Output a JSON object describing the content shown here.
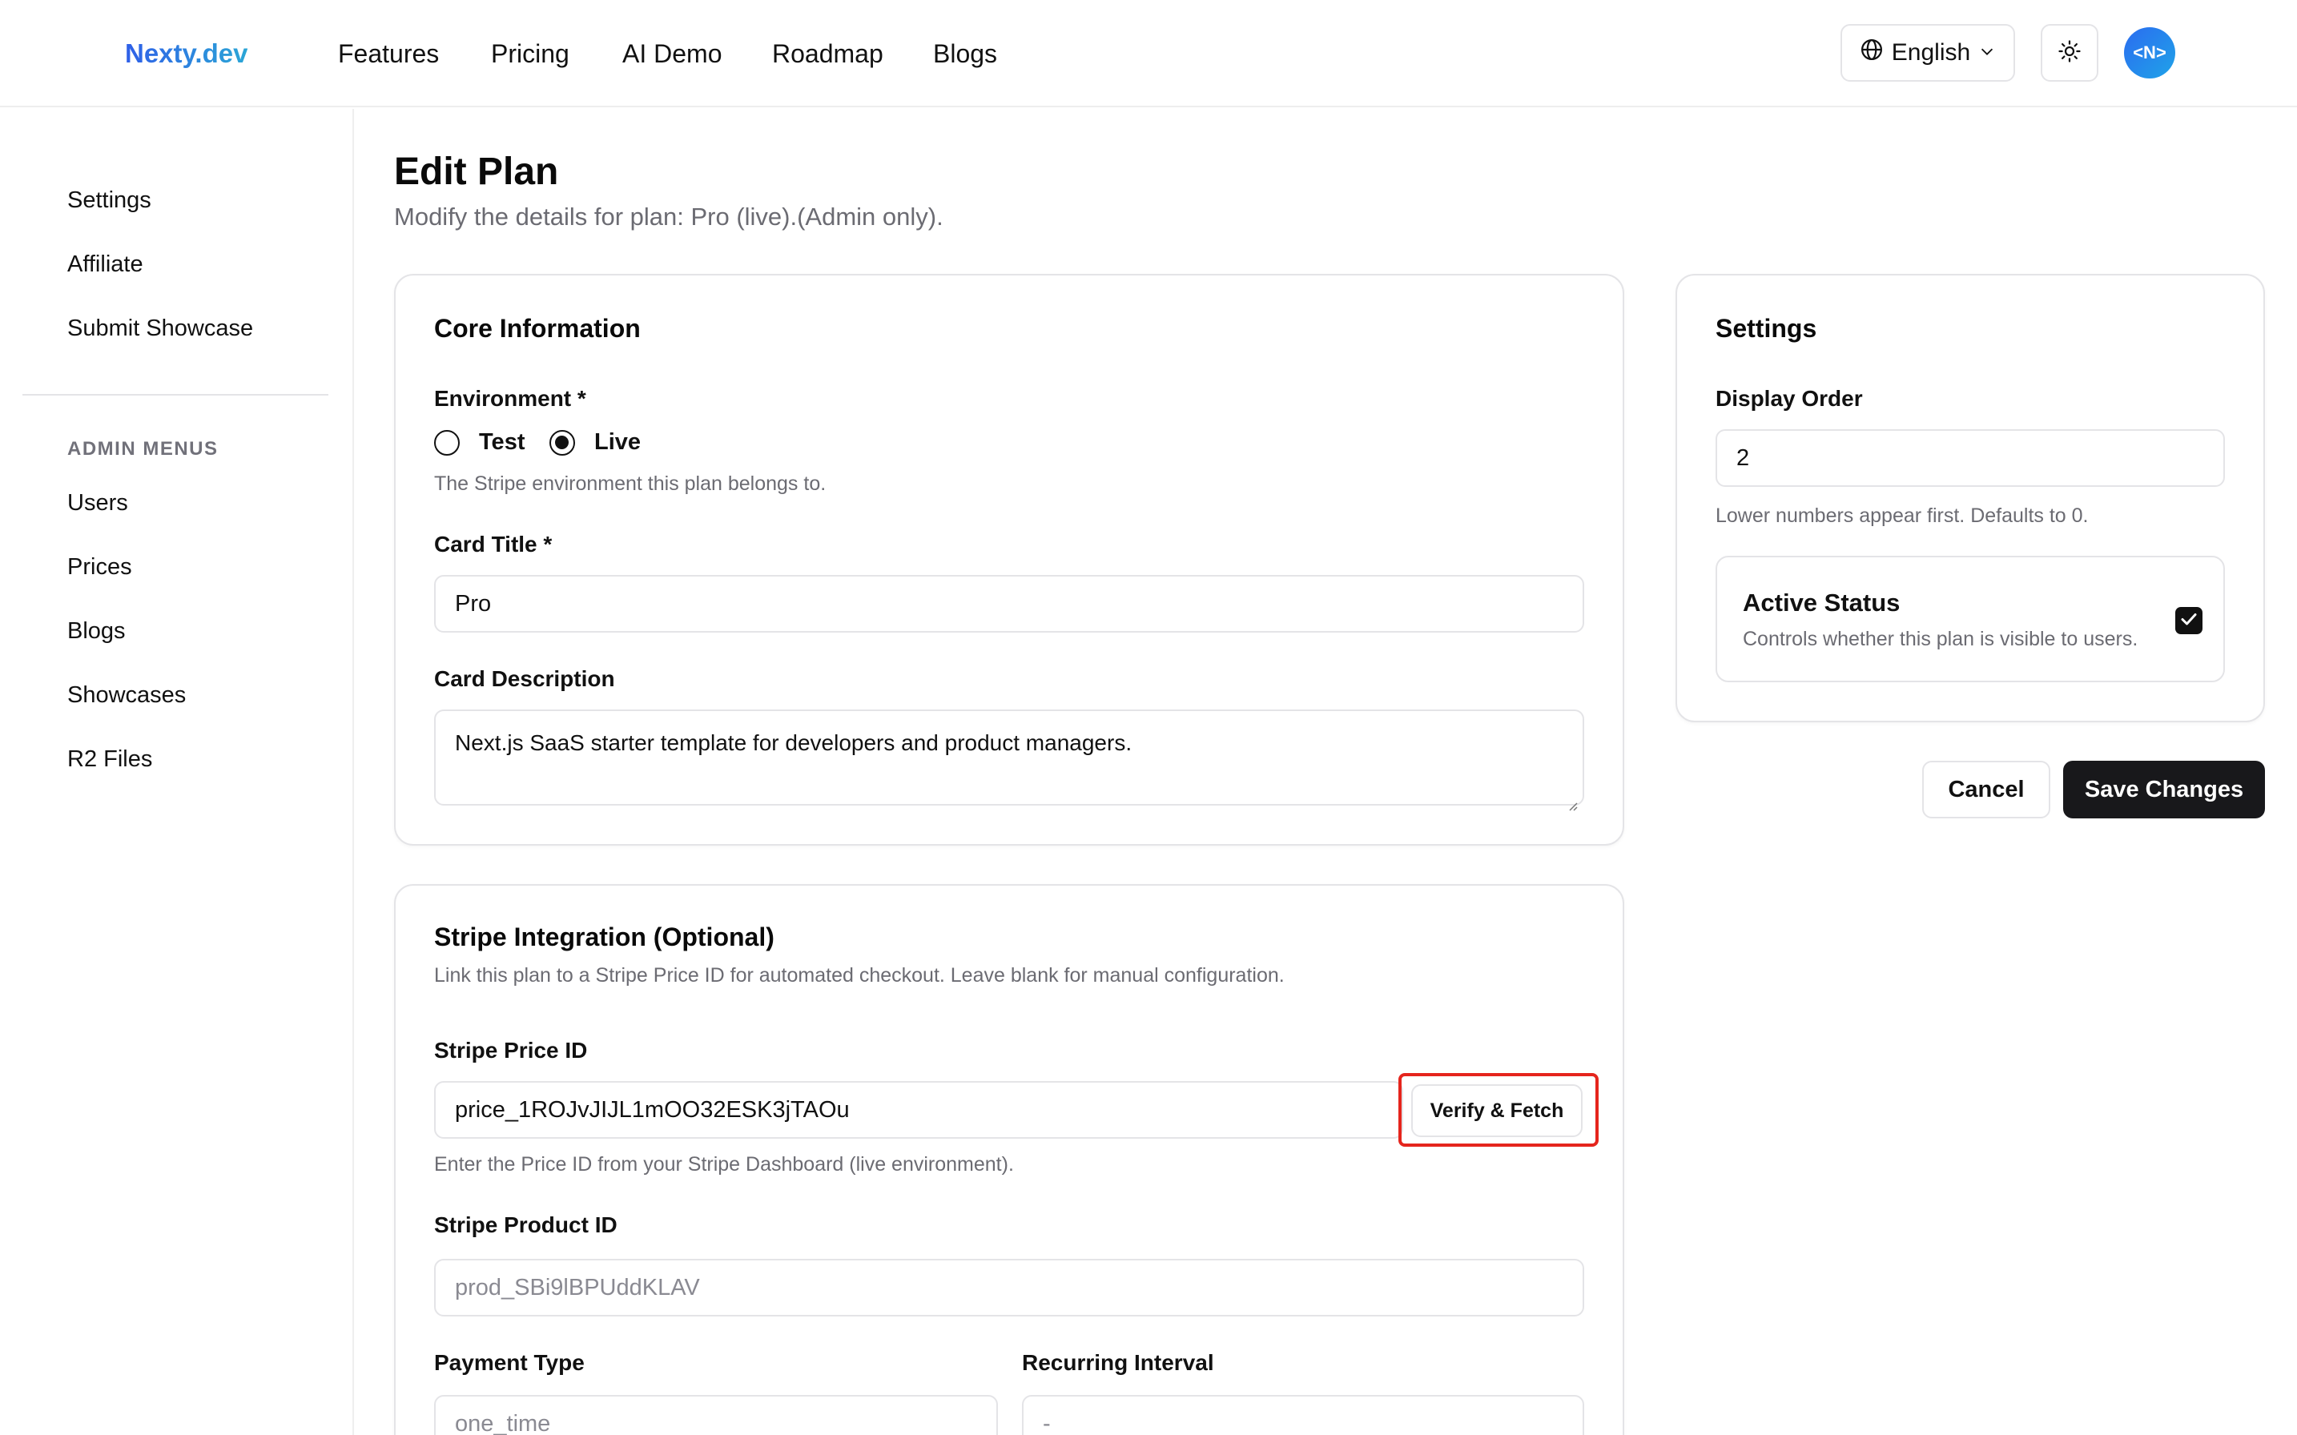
{
  "header": {
    "logo": "Nexty.dev",
    "nav": [
      "Features",
      "Pricing",
      "AI Demo",
      "Roadmap",
      "Blogs"
    ],
    "language": "English",
    "avatar_text": "<N>"
  },
  "sidebar": {
    "items": [
      "Settings",
      "Affiliate",
      "Submit Showcase"
    ],
    "admin_heading": "ADMIN MENUS",
    "admin_items": [
      "Users",
      "Prices",
      "Blogs",
      "Showcases",
      "R2 Files"
    ]
  },
  "page": {
    "title": "Edit Plan",
    "subtitle": "Modify the details for plan: Pro (live).(Admin only)."
  },
  "core": {
    "title": "Core Information",
    "environment_label": "Environment *",
    "env_options": [
      "Test",
      "Live"
    ],
    "env_selected": "Live",
    "environment_help": "The Stripe environment this plan belongs to.",
    "card_title_label": "Card Title *",
    "card_title_value": "Pro",
    "card_description_label": "Card Description",
    "card_description_value": "Next.js SaaS starter template for developers and product managers."
  },
  "stripe": {
    "title": "Stripe Integration (Optional)",
    "description": "Link this plan to a Stripe Price ID for automated checkout. Leave blank for manual configuration.",
    "price_id_label": "Stripe Price ID",
    "price_id_value": "price_1ROJvJIJL1mOO32ESK3jTAOu",
    "verify_button": "Verify & Fetch",
    "price_id_help": "Enter the Price ID from your Stripe Dashboard (live environment).",
    "product_id_label": "Stripe Product ID",
    "product_id_value": "prod_SBi9lBPUddKLAV",
    "payment_type_label": "Payment Type",
    "payment_type_value": "one_time",
    "recurring_interval_label": "Recurring Interval",
    "recurring_interval_value": "-"
  },
  "settings": {
    "title": "Settings",
    "display_order_label": "Display Order",
    "display_order_value": "2",
    "display_order_help": "Lower numbers appear first. Defaults to 0.",
    "active_status_title": "Active Status",
    "active_status_help": "Controls whether this plan is visible to users.",
    "active_checked": true
  },
  "actions": {
    "cancel": "Cancel",
    "save": "Save Changes"
  },
  "colors": {
    "primary_button": "#18181b",
    "highlight": "#e5251d",
    "logo_gradient_start": "#2f5fe8",
    "logo_gradient_end": "#2ba6d6",
    "avatar_gradient": "#2b6cf0"
  }
}
